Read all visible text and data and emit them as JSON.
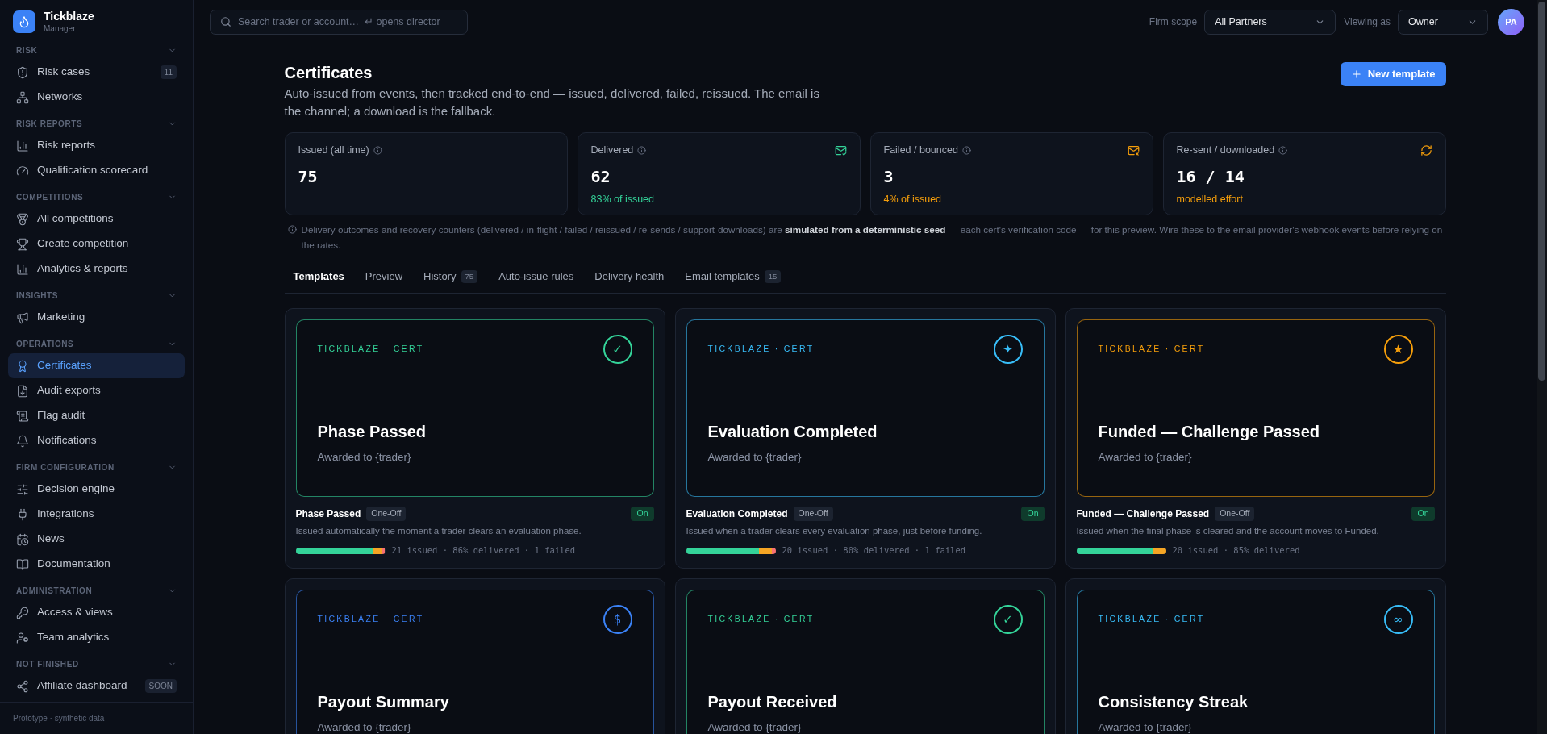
{
  "sidebar": {
    "brand": {
      "name": "Tickblaze",
      "subtitle": "Manager"
    },
    "sections": [
      {
        "label": "RISK",
        "expanded": true,
        "items": [
          {
            "label": "Risk cases",
            "selected": false,
            "badge": "11"
          },
          {
            "label": "Networks",
            "selected": false
          }
        ]
      },
      {
        "label": "RISK REPORTS",
        "expanded": true,
        "items": [
          {
            "label": "Risk reports",
            "selected": false
          },
          {
            "label": "Qualification scorecard",
            "selected": false
          }
        ]
      },
      {
        "label": "COMPETITIONS",
        "expanded": true,
        "items": [
          {
            "label": "All competitions",
            "selected": false
          },
          {
            "label": "Create competition",
            "selected": false
          },
          {
            "label": "Analytics & reports",
            "selected": false
          }
        ]
      },
      {
        "label": "INSIGHTS",
        "expanded": true,
        "items": [
          {
            "label": "Marketing",
            "selected": false
          }
        ]
      },
      {
        "label": "OPERATIONS",
        "expanded": true,
        "items": [
          {
            "label": "Certificates",
            "selected": true
          },
          {
            "label": "Audit exports",
            "selected": false
          },
          {
            "label": "Flag audit",
            "selected": false
          },
          {
            "label": "Notifications",
            "selected": false
          }
        ]
      },
      {
        "label": "FIRM CONFIGURATION",
        "expanded": true,
        "items": [
          {
            "label": "Decision engine",
            "selected": false
          },
          {
            "label": "Integrations",
            "selected": false
          },
          {
            "label": "News",
            "selected": false
          },
          {
            "label": "Documentation",
            "selected": false
          }
        ]
      },
      {
        "label": "ADMINISTRATION",
        "expanded": true,
        "items": [
          {
            "label": "Access & views",
            "selected": false
          },
          {
            "label": "Team analytics",
            "selected": false
          }
        ]
      },
      {
        "label": "NOT FINISHED",
        "expanded": true,
        "items": [
          {
            "label": "Affiliate dashboard",
            "selected": false,
            "badge": "SOON"
          }
        ]
      }
    ],
    "footer": "Prototype · synthetic data"
  },
  "topbar": {
    "search": {
      "placeholder": "Search trader or account…  ↵ opens director"
    },
    "firm_scope": {
      "label": "Firm scope",
      "value": "All Partners"
    },
    "viewing_as": {
      "label": "Viewing as",
      "value": "Owner"
    },
    "avatar": "PA"
  },
  "page": {
    "title": "Certificates",
    "description": "Auto-issued from events, then tracked end-to-end — issued, delivered, failed, reissued. The email is the channel; a download is the fallback.",
    "primary_button": "New template"
  },
  "stats": [
    {
      "kind": "total",
      "label": "Issued (all time)",
      "value": "75"
    },
    {
      "kind": "delivered",
      "label": "Delivered",
      "value": "62",
      "caption": "83% of issued",
      "color": "#34d399"
    },
    {
      "kind": "failed",
      "label": "Failed / bounced",
      "value": "3",
      "caption": "4% of issued",
      "color": "#f59e0b"
    },
    {
      "kind": "resent",
      "label": "Re-sent / downloaded",
      "value": "16 / 14",
      "caption": "modelled effort",
      "color": "#f59e0b"
    }
  ],
  "note": "Delivery outcomes and recovery counters (delivered / in-flight / failed / reissued / re-sends / support-downloads) are **simulated from a deterministic seed** — each cert's verification code — for this preview. Wire these to the email provider's webhook events before relying on the rates.",
  "tabs": [
    {
      "label": "Templates",
      "selected": true
    },
    {
      "label": "Preview",
      "selected": false
    },
    {
      "label": "History",
      "count": "75",
      "selected": false
    },
    {
      "label": "Auto-issue rules",
      "selected": false
    },
    {
      "label": "Delivery health",
      "selected": false
    },
    {
      "label": "Email templates",
      "count": "15",
      "selected": false
    }
  ],
  "templates": [
    {
      "brand": "TICKBLAZE · CERT",
      "glyph": "✓",
      "color": "#34d399",
      "title": "Phase Passed",
      "awarded": "Awarded to {trader}",
      "name": "Phase Passed",
      "frequency": "One-Off",
      "enabled": true,
      "status": "On",
      "description": "Issued automatically the moment a trader clears an evaluation phase.",
      "delivery": [
        {
          "kind": "delivered",
          "level": 0.86
        },
        {
          "kind": "in_flight",
          "level": 0.1
        },
        {
          "kind": "failed",
          "level": 0.04
        }
      ],
      "summary": "21 issued · 86% delivered · 1 failed"
    },
    {
      "brand": "TICKBLAZE · CERT",
      "glyph": "✦",
      "color": "#38bdf8",
      "title": "Evaluation Completed",
      "awarded": "Awarded to {trader}",
      "name": "Evaluation Completed",
      "frequency": "One-Off",
      "enabled": true,
      "status": "On",
      "description": "Issued when a trader clears every evaluation phase, just before funding.",
      "delivery": [
        {
          "kind": "delivered",
          "level": 0.81
        },
        {
          "kind": "in_flight",
          "level": 0.14
        },
        {
          "kind": "failed",
          "level": 0.05
        }
      ],
      "summary": "20 issued · 80% delivered · 1 failed"
    },
    {
      "brand": "TICKBLAZE · CERT",
      "glyph": "★",
      "color": "#f59e0b",
      "title": "Funded — Challenge Passed",
      "awarded": "Awarded to {trader}",
      "name": "Funded — Challenge Passed",
      "frequency": "One-Off",
      "enabled": true,
      "status": "On",
      "description": "Issued when the final phase is cleared and the account moves to Funded.",
      "delivery": [
        {
          "kind": "delivered",
          "level": 0.85
        },
        {
          "kind": "in_flight",
          "level": 0.15
        }
      ],
      "summary": "20 issued · 85% delivered"
    },
    {
      "brand": "TICKBLAZE · CERT",
      "glyph": "$",
      "color": "#3b82f6",
      "title": "Payout Summary",
      "awarded": "Awarded to {trader}"
    },
    {
      "brand": "TICKBLAZE · CERT",
      "glyph": "✓",
      "color": "#34d399",
      "title": "Payout Received",
      "awarded": "Awarded to {trader}"
    },
    {
      "brand": "TICKBLAZE · CERT",
      "glyph": "∞",
      "color": "#38bdf8",
      "title": "Consistency Streak",
      "awarded": "Awarded to {trader}"
    }
  ]
}
